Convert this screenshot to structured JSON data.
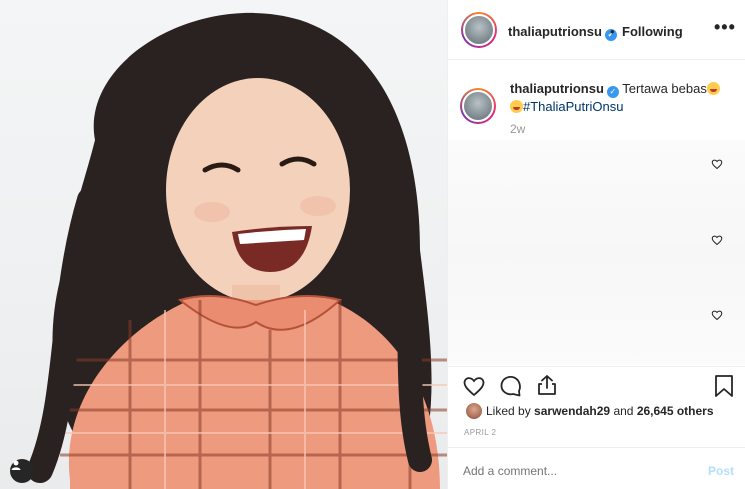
{
  "post": {
    "username": "thaliaputrionsu",
    "follow_status": "Following",
    "separator": "•",
    "more_label": "•••",
    "caption_text": "Tertawa bebas",
    "hashtag": "#ThaliaPutriOnsu",
    "time_ago": "2w",
    "liked_by_prefix": "Liked by",
    "liked_by_user": "sarwendah29",
    "and_label": "and",
    "likes_count": "26,645 others",
    "date": "APRIL 2",
    "comment_placeholder": "Add a comment...",
    "post_label": "Post"
  },
  "icons": {
    "verified": "verified-badge-icon",
    "like": "heart-icon",
    "comment": "comment-icon",
    "share": "share-icon",
    "save": "bookmark-icon",
    "user_tag": "user-tag-icon"
  },
  "colors": {
    "verified": "#3897f0",
    "hashtag": "#003569",
    "post_disabled": "#b2dffc",
    "muted": "#999999"
  }
}
